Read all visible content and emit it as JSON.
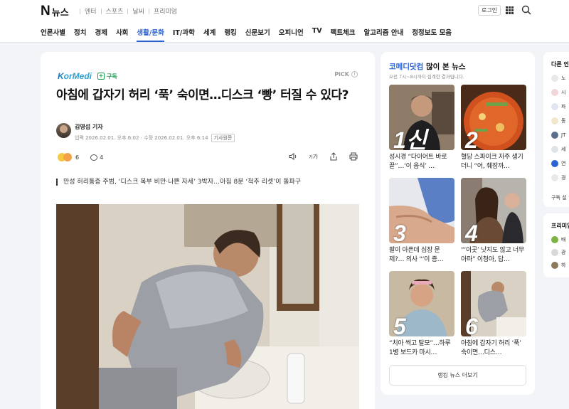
{
  "header": {
    "logo_n": "N",
    "logo_text": "뉴스",
    "top_menu": [
      "엔터",
      "스포츠",
      "날씨",
      "프리미엄"
    ],
    "login": "로그인",
    "nav": [
      "언론사별",
      "정치",
      "경제",
      "사회",
      "생활/문화",
      "IT/과학",
      "세계",
      "랭킹",
      "신문보기",
      "오피니언",
      "TV",
      "팩트체크",
      "알고리즘 안내",
      "정정보도 모음"
    ],
    "active_nav": "생활/문화",
    "accent": "#2a63d4"
  },
  "article": {
    "press_logo_k": "K",
    "press_logo_rest": "orMedi",
    "subscribe": "구독",
    "pick": "PiCK",
    "headline": "아침에 갑자기 허리 ‘푹’ 숙이면…디스크 ‘빵’ 터질 수 있다?",
    "reporter": "김영섭 기자",
    "dates": "입력 2026.02.01. 오후 6:02 · 수정 2026.02.01. 오후 6:14",
    "source_tag": "기사원문",
    "reaction_count": "6",
    "comment_count": "4",
    "font_tool": "가",
    "summary": "만성 허리통증 주범, ‘디스크 복부 비만·나쁜 자세’ 3박자…아침 8분 ‘척추 리셋’이 돌파구"
  },
  "ranking": {
    "press_name": "코메디닷컴",
    "title_suffix": " 많이 본 뉴스",
    "subtitle": "오전 7시~8시까지 집계한 결과입니다.",
    "items": [
      {
        "num": "1",
        "overlay": "1신",
        "text": "성시경 “다이어트 바로 끝”…‘이 음식’ …"
      },
      {
        "num": "2",
        "overlay": "2",
        "text": "혈당 스파이크 자주 생기더니 “어, 췌장까…"
      },
      {
        "num": "3",
        "overlay": "3",
        "text": "팔이 아픈데 심장 문제?… 의사 “‘이 증…"
      },
      {
        "num": "4",
        "overlay": "4",
        "text": "“‘이곳’ 낫지도 않고 너무 아파” 이청아, 답…"
      },
      {
        "num": "5",
        "overlay": "5",
        "text": "“치아 썩고 탈모”…하루 1병 보드카 마시…"
      },
      {
        "num": "6",
        "overlay": "6",
        "text": "아침에 갑자기 허리 ‘푹’ 숙이면…디스…"
      }
    ],
    "more": "랭킹 뉴스 더보기"
  },
  "side": {
    "title": "다른 언론",
    "items": [
      "노",
      "시",
      "파",
      "동",
      "JT",
      "세",
      "연",
      "경"
    ],
    "more": "구독 설",
    "premium_title": "프리미엄",
    "premium_items": [
      "배",
      "광",
      "하"
    ]
  }
}
